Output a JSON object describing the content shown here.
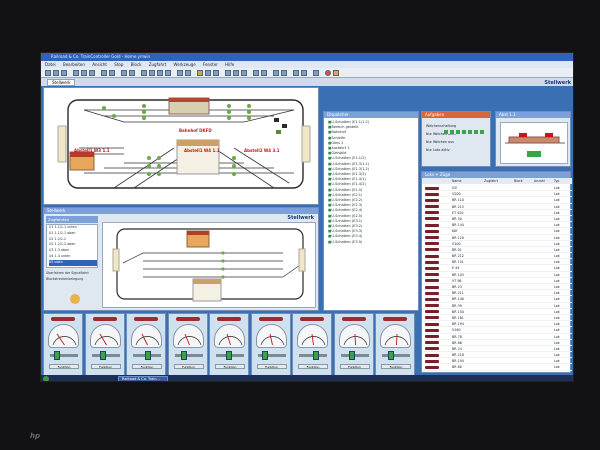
{
  "window": {
    "title": "Railroad & Co. TrainController Gold - Home.yrrwin"
  },
  "menu": {
    "items": [
      "Datei",
      "Bearbeiten",
      "Ansicht",
      "Stop",
      "Block",
      "Zugfahrt",
      "Werkzeuge",
      "Fenster",
      "Hilfe"
    ]
  },
  "tabs": {
    "main": "Stellwerk",
    "dispatcher": "Dispatcher"
  },
  "stellwerk": {
    "heading": "Stellwerk",
    "labels": [
      "Bahnhof DKFD",
      "Abstell1 W3 1.1",
      "Abstell1 W4 1.1",
      "Abstell2 W4 3.1"
    ]
  },
  "lower_panel": {
    "title": "Stellwerk",
    "heading": "Stellwerk",
    "list_title": "Zugfahrten",
    "list_items": [
      "U1 1.1/1.1 unten",
      "U1 1.1/1.1 oben",
      "U2 1.2/1.2",
      "U2 1.2/1.2 oben",
      "U3 1.3 oben",
      "U4 1.4 unten",
      "U5 oben"
    ],
    "sub_items": [
      "Überfahren der Signalfahrt",
      "Blockstreckenbelegung"
    ]
  },
  "explorer": {
    "title": "Dispatcher",
    "items": [
      "U-Schatten (E1.1/1.2)",
      "Bereich gestellt",
      "Bahnhof",
      "Schleife",
      "Gleis 1",
      "Ausfahrt 1",
      "Gleisbild",
      "U-Schatten (E1.1/2)",
      "U-Schatten (E1.3/1.1)",
      "U-Schatten (E1.3/1.2)",
      "U-Schatten (E1.3/2)",
      "U-Schatten (E1.4/1)",
      "U-Schatten (E1.4/2)",
      "U-Schatten (E1.5)",
      "U-Schatten (E2.1)",
      "U-Schatten (E2.2)",
      "U-Schatten (E2.3)",
      "U-Schatten (E2.4)",
      "U-Schatten (E2.5)",
      "U-Schatten (E3.1)",
      "U-Schatten (E3.2)",
      "U-Schatten (E3.3)",
      "U-Schatten (E3.4)",
      "U-Schatten (E3.5)"
    ]
  },
  "ops": {
    "title": "Aufgaben",
    "lines": [
      "Weichenschaltung",
      "Nur Weichen aktiv",
      "Nur Weichen aus",
      "Nur Loks aktiv"
    ]
  },
  "preview": {
    "title": "Abst 1.1"
  },
  "loco_list": {
    "title": "Loks + Züge",
    "columns": [
      "Name",
      "Zugfahrt",
      "Block",
      "Anzahl",
      "Typ"
    ],
    "rows": [
      {
        "name": "ICE",
        "block": "",
        "typ": "Lok"
      },
      {
        "name": "V200",
        "block": "",
        "typ": "Lok"
      },
      {
        "name": "BR 110",
        "block": "",
        "typ": "Lok"
      },
      {
        "name": "BR 215",
        "block": "",
        "typ": "Lok"
      },
      {
        "name": "ET 420",
        "block": "",
        "typ": "Lok"
      },
      {
        "name": "BR 50",
        "block": "",
        "typ": "Lok"
      },
      {
        "name": "BR 144",
        "block": "",
        "typ": "Lok"
      },
      {
        "name": "Köf",
        "block": "",
        "typ": "Lok"
      },
      {
        "name": "BR 120",
        "block": "",
        "typ": "Lok"
      },
      {
        "name": "V100",
        "block": "",
        "typ": "Lok"
      },
      {
        "name": "BR 01",
        "block": "",
        "typ": "Lok"
      },
      {
        "name": "BR 212",
        "block": "",
        "typ": "Lok"
      },
      {
        "name": "BR 151",
        "block": "",
        "typ": "Lok"
      },
      {
        "name": "E 44",
        "block": "",
        "typ": "Lok"
      },
      {
        "name": "BR 103",
        "block": "",
        "typ": "Lok"
      },
      {
        "name": "VT 98",
        "block": "",
        "typ": "Lok"
      },
      {
        "name": "BR 23",
        "block": "",
        "typ": "Lok"
      },
      {
        "name": "BR 211",
        "block": "",
        "typ": "Lok"
      },
      {
        "name": "BR 140",
        "block": "",
        "typ": "Lok"
      },
      {
        "name": "BR 39",
        "block": "",
        "typ": "Lok"
      },
      {
        "name": "BR 150",
        "block": "",
        "typ": "Lok"
      },
      {
        "name": "BR 181",
        "block": "",
        "typ": "Lok"
      },
      {
        "name": "BR 194",
        "block": "",
        "typ": "Lok"
      },
      {
        "name": "V160",
        "block": "",
        "typ": "Lok"
      },
      {
        "name": "BR 78",
        "block": "",
        "typ": "Lok"
      },
      {
        "name": "BR 86",
        "block": "",
        "typ": "Lok"
      },
      {
        "name": "BR 24",
        "block": "",
        "typ": "Lok"
      },
      {
        "name": "BR 218",
        "block": "",
        "typ": "Lok"
      },
      {
        "name": "BR 194",
        "block": "",
        "typ": "Lok"
      },
      {
        "name": "BR 80",
        "block": "",
        "typ": "Lok"
      }
    ]
  },
  "cabs": {
    "button_label": "Funktion",
    "count": 9
  },
  "taskbar": {
    "task": "Railroad & Co. Train..."
  },
  "brand": "hp",
  "colors": {
    "accent": "#7ca1d8",
    "signal_red": "#c4161c",
    "active_green": "#3aa24a",
    "loco": "#7a1e2a"
  }
}
